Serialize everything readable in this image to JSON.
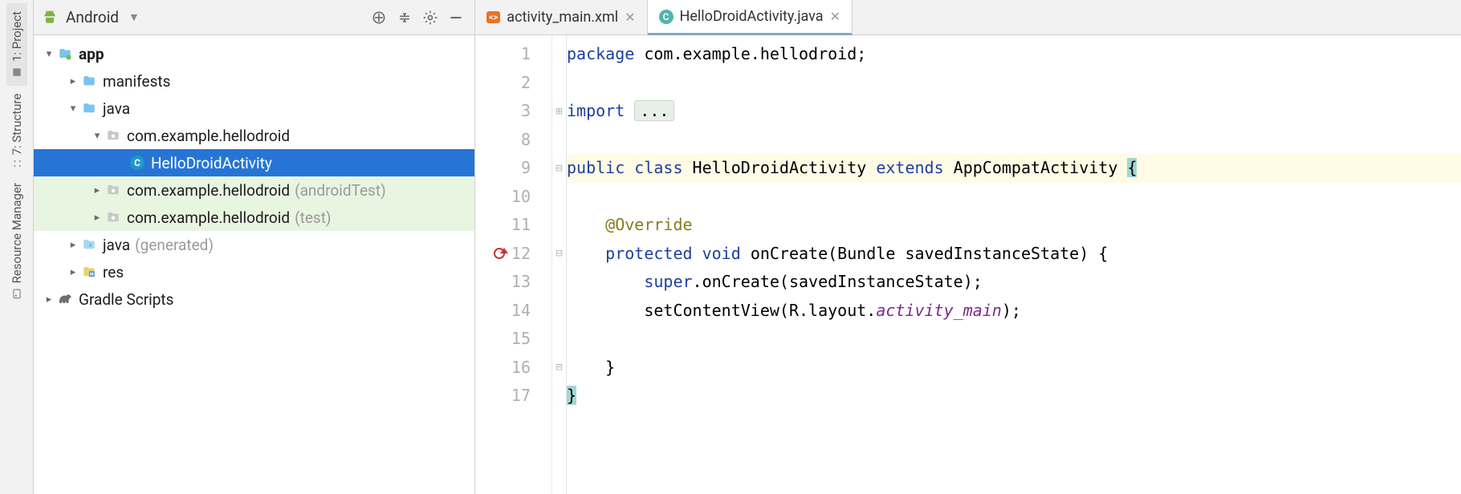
{
  "left_tabs": [
    {
      "label": "1: Project"
    },
    {
      "label": "7: Structure"
    },
    {
      "label": "Resource Manager"
    }
  ],
  "panel": {
    "view_name": "Android"
  },
  "tree": {
    "app": "app",
    "manifests": "manifests",
    "java": "java",
    "pkg_main": "com.example.hellodroid",
    "activity": "HelloDroidActivity",
    "pkg_android_test": "com.example.hellodroid",
    "pkg_android_test_suffix": "(androidTest)",
    "pkg_test": "com.example.hellodroid",
    "pkg_test_suffix": "(test)",
    "java_gen": "java",
    "java_gen_suffix": "(generated)",
    "res": "res",
    "gradle": "Gradle Scripts"
  },
  "tabs": [
    {
      "label": "activity_main.xml",
      "type": "xml",
      "active": false
    },
    {
      "label": "HelloDroidActivity.java",
      "type": "class",
      "active": true
    }
  ],
  "gutter_lines": [
    "1",
    "2",
    "3",
    "8",
    "9",
    "10",
    "11",
    "12",
    "13",
    "14",
    "15",
    "16",
    "17"
  ],
  "code": {
    "l1_kw": "package",
    "l1_rest": " com.example.hellodroid;",
    "l3_kw": "import ",
    "l3_fold": "...",
    "l9_public": "public ",
    "l9_class": "class ",
    "l9_name": "HelloDroidActivity ",
    "l9_extends": "extends ",
    "l9_parent": "AppCompatActivity ",
    "l9_brace": "{",
    "l11_ann": "@Override",
    "l12_protected": "protected ",
    "l12_void": "void ",
    "l12_sig": "onCreate(Bundle savedInstanceState) {",
    "l13_super": "super",
    "l13_rest": ".onCreate(savedInstanceState);",
    "l14_a": "setContentView(R.layout.",
    "l14_field": "activity_main",
    "l14_b": ");",
    "l16": "}",
    "l17": "}"
  }
}
